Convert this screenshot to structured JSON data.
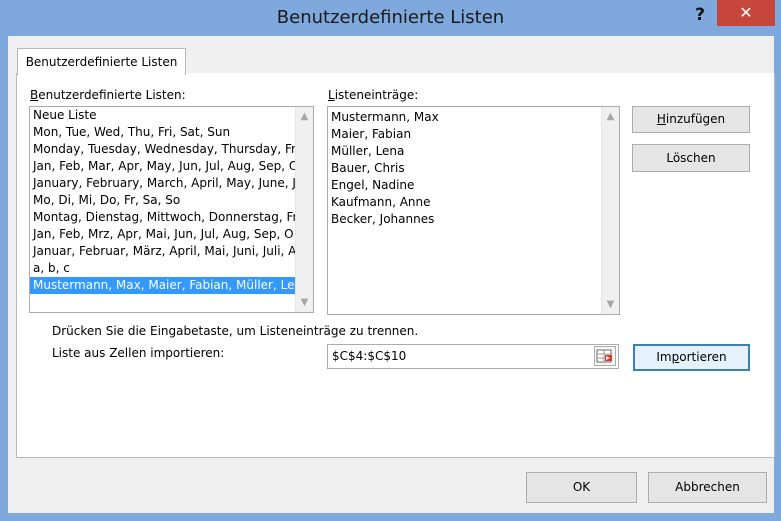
{
  "window": {
    "title": "Benutzerdefinierte Listen",
    "help_label": "?",
    "close_label": "✕"
  },
  "tab": {
    "label": "Benutzerdefinierte Listen"
  },
  "custom_lists": {
    "label_accel": "B",
    "label_rest": "enutzerdefinierte Listen:",
    "items": [
      "Neue Liste",
      "Mon, Tue, Wed, Thu, Fri, Sat, Sun",
      "Monday, Tuesday, Wednesday, Thursday, Fr",
      "Jan, Feb, Mar, Apr, May, Jun, Jul, Aug, Sep, O",
      "January, February, March, April, May, June, J",
      "Mo, Di, Mi, Do, Fr, Sa, So",
      "Montag, Dienstag, Mittwoch, Donnerstag, Fr",
      "Jan, Feb, Mrz, Apr, Mai, Jun, Jul, Aug, Sep, O",
      "Januar, Februar, März, April, Mai, Juni, Juli, A",
      "a, b, c",
      "Mustermann, Max, Maier, Fabian, Müller, Le"
    ],
    "selected_index": 10
  },
  "list_entries": {
    "label_accel": "L",
    "label_rest": "isteneinträge:",
    "items": [
      "Mustermann, Max",
      "Maier, Fabian",
      "Müller, Lena",
      "Bauer, Chris",
      "Engel, Nadine",
      "Kaufmann, Anne",
      "Becker, Johannes"
    ]
  },
  "buttons": {
    "add_accel": "H",
    "add_rest": "inzufügen",
    "delete_label": "Löschen",
    "import_pre": "Im",
    "import_accel": "p",
    "import_rest": "ortieren",
    "ok_label": "OK",
    "cancel_label": "Abbrechen"
  },
  "hint_text": "Drücken Sie die Eingabetaste, um Listeneinträge zu trennen.",
  "import": {
    "label": "Liste aus Zellen importieren:",
    "value": "$C$4:$C$10"
  }
}
